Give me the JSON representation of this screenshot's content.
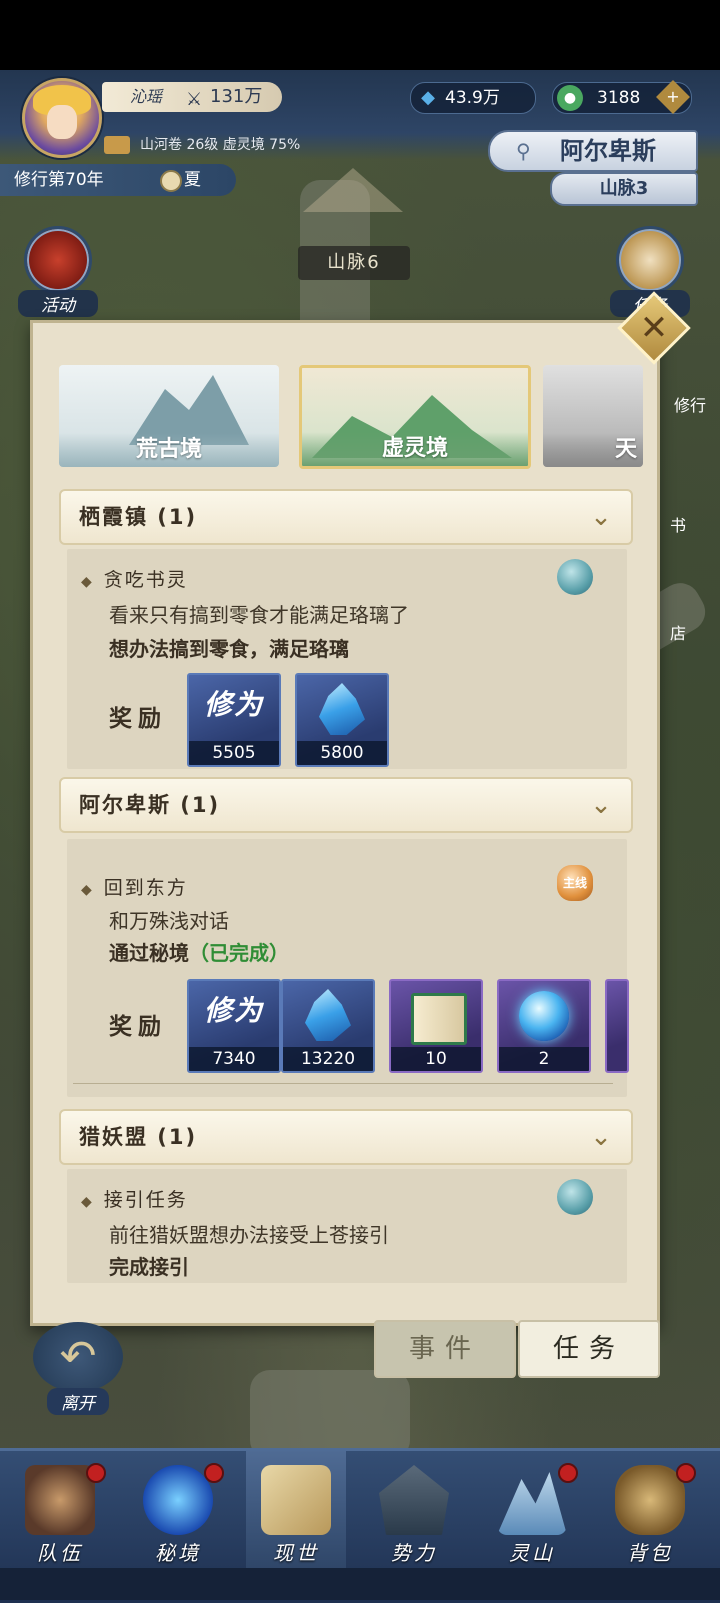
{
  "player": {
    "name": "沁瑶",
    "power": "131万",
    "book_info": "山河卷 26级 虚灵境 75%",
    "year_label": "修行第70年",
    "season": "夏"
  },
  "resources": {
    "spirit": "43.9万",
    "jade": "3188"
  },
  "location": {
    "region": "阿尔卑斯",
    "sub": "山脉3",
    "map_tag": "山脉6"
  },
  "side_buttons": {
    "activity": "活动",
    "task": "任务",
    "cultivate_partial": "修行",
    "book_partial": "书",
    "shop_partial": "店"
  },
  "realms": [
    {
      "label": "荒古境"
    },
    {
      "label": "虚灵境"
    },
    {
      "label": "天"
    }
  ],
  "groups": [
    {
      "header": "栖霞镇 (1)",
      "quest_title": "贪吃书灵",
      "desc": "看来只有搞到零食才能满足珞璃了",
      "goal": "想办法搞到零食，满足珞璃",
      "reward_label": "奖励",
      "rewards": [
        {
          "name": "修为",
          "count": "5505"
        },
        {
          "name": "灵石",
          "count": "5800"
        }
      ]
    },
    {
      "header": "阿尔卑斯 (1)",
      "quest_title": "回到东方",
      "badge": "主线",
      "desc": "和万殊浅对话",
      "goal": "通过秘境",
      "goal_status": "（已完成）",
      "reward_label": "奖励",
      "rewards": [
        {
          "name": "修为",
          "count": "7340"
        },
        {
          "name": "灵石",
          "count": "13220"
        },
        {
          "name": "书卷",
          "count": "10"
        },
        {
          "name": "灵珠",
          "count": "2"
        }
      ]
    },
    {
      "header": "猎妖盟 (1)",
      "quest_title": "接引任务",
      "desc": "前往猎妖盟想办法接受上苍接引",
      "goal": "完成接引"
    }
  ],
  "bottom_tabs": {
    "events": "事件",
    "tasks": "任务",
    "leave": "离开"
  },
  "nav": [
    {
      "label": "队伍"
    },
    {
      "label": "秘境"
    },
    {
      "label": "现世"
    },
    {
      "label": "势力"
    },
    {
      "label": "灵山"
    },
    {
      "label": "背包"
    }
  ],
  "colors": {
    "panel_bg": "#e8e0cb",
    "nav_bg": "#1e3050",
    "completed_green": "#2f8d35",
    "reward_blue": "#2a3c70",
    "reward_purple": "#3a2e6c"
  }
}
